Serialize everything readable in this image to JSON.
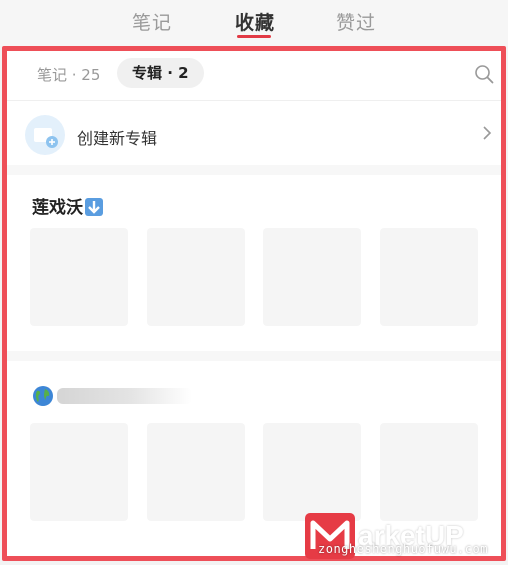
{
  "top_tabs": {
    "notes": "笔记",
    "favorites": "收藏",
    "likes": "赞过"
  },
  "sub_tabs": {
    "notes": "笔记 · 25",
    "albums": "专辑 · 2"
  },
  "create_album": {
    "label": "创建新专辑"
  },
  "albums": [
    {
      "title": "莲戏沃",
      "emoji": "down-arrow-emoji"
    },
    {
      "title": "",
      "emoji": "globe-emoji"
    }
  ],
  "watermark": {
    "brand": "arketUP",
    "url": "zongheshenghuofuwu.com"
  },
  "colors": {
    "accent": "#e23a45",
    "highlight_frame": "#ee4f58",
    "placeholder": "#f5f5f5"
  }
}
